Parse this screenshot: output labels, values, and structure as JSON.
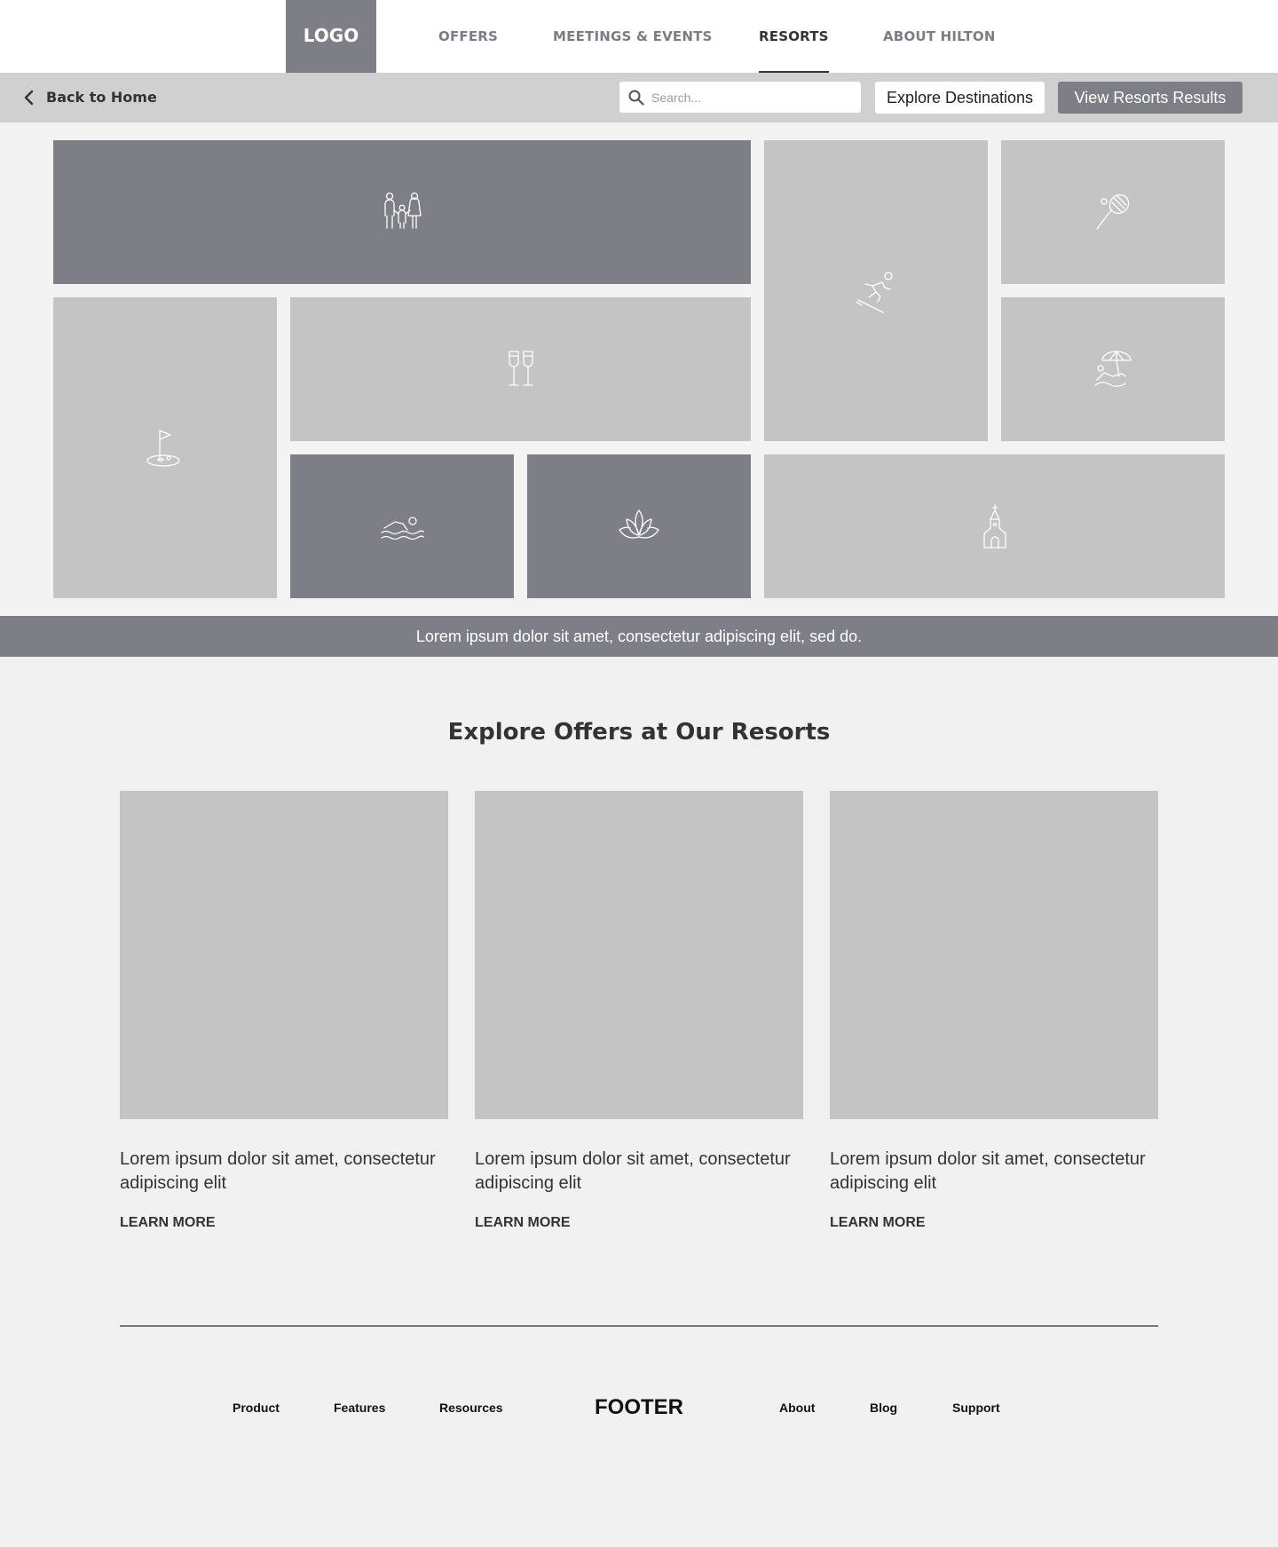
{
  "header": {
    "logo": "LOGO",
    "nav": [
      "OFFERS",
      "MEETINGS & EVENTS",
      "RESORTS",
      "ABOUT HILTON"
    ],
    "active_nav": "RESORTS"
  },
  "subbar": {
    "back_label": "Back to Home",
    "search_placeholder": "Search...",
    "explore_label": "Explore Destinations",
    "view_label": "View Resorts Results"
  },
  "hero": {
    "tiles": [
      {
        "icon": "family-icon",
        "shade": "dark"
      },
      {
        "icon": "skiing-icon",
        "shade": "light"
      },
      {
        "icon": "tennis-icon",
        "shade": "light"
      },
      {
        "icon": "golf-icon",
        "shade": "light"
      },
      {
        "icon": "champagne-icon",
        "shade": "light"
      },
      {
        "icon": "beach-icon",
        "shade": "light"
      },
      {
        "icon": "swimming-icon",
        "shade": "dark"
      },
      {
        "icon": "lotus-spa-icon",
        "shade": "dark"
      },
      {
        "icon": "chapel-icon",
        "shade": "light"
      }
    ]
  },
  "banner": {
    "text": "Lorem ipsum dolor sit amet, consectetur adipiscing elit, sed do."
  },
  "offers": {
    "title": "Explore Offers at Our Resorts",
    "cards": [
      {
        "text": "Lorem ipsum dolor sit amet, consectetur adipiscing elit",
        "link": "LEARN MORE"
      },
      {
        "text": "Lorem ipsum dolor sit amet, consectetur adipiscing elit",
        "link": "LEARN MORE"
      },
      {
        "text": "Lorem ipsum dolor sit amet, consectetur adipiscing elit",
        "link": "LEARN MORE"
      }
    ]
  },
  "footer": {
    "title": "FOOTER",
    "left_links": [
      "Product",
      "Features",
      "Resources"
    ],
    "right_links": [
      "About",
      "Blog",
      "Support"
    ]
  },
  "colors": {
    "dark_gray": "#7e7e86",
    "light_gray": "#c4c4c4",
    "subbar_gray": "#d0d0d0",
    "page_bg": "#f1f1f1"
  }
}
